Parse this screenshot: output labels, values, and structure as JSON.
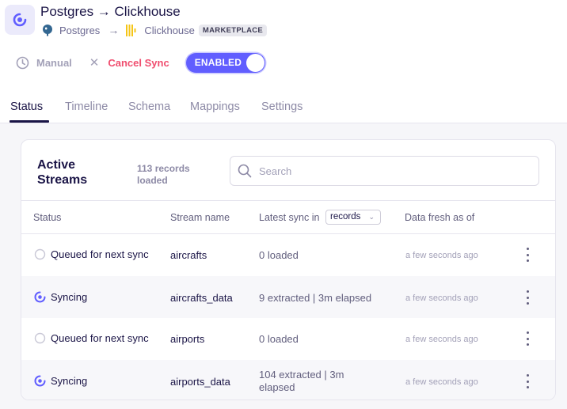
{
  "header": {
    "title": "Postgres → Clickhouse",
    "source": "Postgres",
    "arrow": "→",
    "destination": "Clickhouse",
    "badge": "MARKETPLACE"
  },
  "actions": {
    "manual_label": "Manual",
    "cancel_label": "Cancel Sync",
    "toggle_label": "ENABLED",
    "toggle_state": "on",
    "accent_color": "#615eff",
    "cancel_color": "#f04e6f"
  },
  "tabs": [
    {
      "label": "Status",
      "active": true
    },
    {
      "label": "Timeline",
      "active": false
    },
    {
      "label": "Schema",
      "active": false
    },
    {
      "label": "Mappings",
      "active": false
    },
    {
      "label": "Settings",
      "active": false
    }
  ],
  "card": {
    "title": "Active Streams",
    "record_count": "113 records loaded",
    "search_placeholder": "Search"
  },
  "table": {
    "columns": {
      "status": "Status",
      "stream_name": "Stream name",
      "latest_sync": "Latest sync in",
      "latest_unit": "records",
      "data_fresh": "Data fresh as of"
    },
    "rows": [
      {
        "status": "Queued for next sync",
        "status_icon": "queued-circle-icon",
        "stream": "aircrafts",
        "latest": "0 loaded",
        "fresh": "a few seconds ago"
      },
      {
        "status": "Syncing",
        "status_icon": "syncing-spinner-icon",
        "stream": "aircrafts_data",
        "latest": "9 extracted | 3m elapsed",
        "fresh": "a few seconds ago"
      },
      {
        "status": "Queued for next sync",
        "status_icon": "queued-circle-icon",
        "stream": "airports",
        "latest": "0 loaded",
        "fresh": "a few seconds ago"
      },
      {
        "status": "Syncing",
        "status_icon": "syncing-spinner-icon",
        "stream": "airports_data",
        "latest_line1": "104 extracted | 3m",
        "latest_line2": "elapsed",
        "fresh": "a few seconds ago"
      }
    ]
  }
}
